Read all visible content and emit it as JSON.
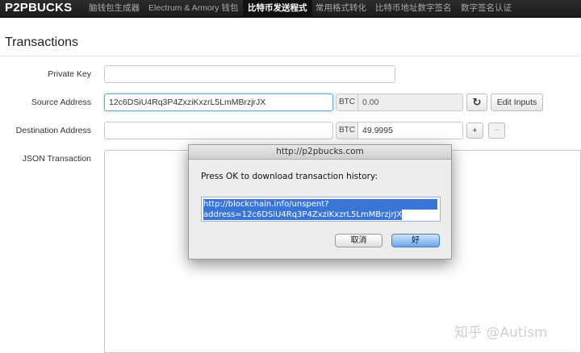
{
  "navbar": {
    "brand": "P2PBUCKS",
    "items": [
      {
        "label": "脑钱包生成器"
      },
      {
        "label": "Electrum & Armory 钱包"
      },
      {
        "label": "比特币发送程式"
      },
      {
        "label": "常用格式转化"
      },
      {
        "label": "比特币地址数字签名"
      },
      {
        "label": "数字签名认证"
      }
    ],
    "active_index": 2
  },
  "page": {
    "title": "Transactions"
  },
  "form": {
    "private_key_label": "Private Key",
    "private_key_value": "",
    "source_label": "Source Address",
    "source_value": "12c6DSiU4Rq3P4ZxziKxzrL5LmMBrzjrJX",
    "source_unit": "BTC",
    "source_amount": "0.00",
    "refresh_icon": "↻",
    "edit_inputs_label": "Edit Inputs",
    "dest_label": "Destination Address",
    "dest_value": "",
    "dest_unit": "BTC",
    "dest_amount": "49.9995",
    "add_label": "+",
    "remove_label": "−",
    "json_label": "JSON Transaction"
  },
  "dialog": {
    "title": "http://p2pbucks.com",
    "message": "Press OK to download transaction history:",
    "url_line1": "http://blockchain.info/unspent?",
    "url_line2": "address=12c6DSiU4Rq3P4ZxziKxzrL5LmMBrzjrJX",
    "cancel_label": "取消",
    "ok_label": "好"
  },
  "watermark": "知乎 @Autism"
}
